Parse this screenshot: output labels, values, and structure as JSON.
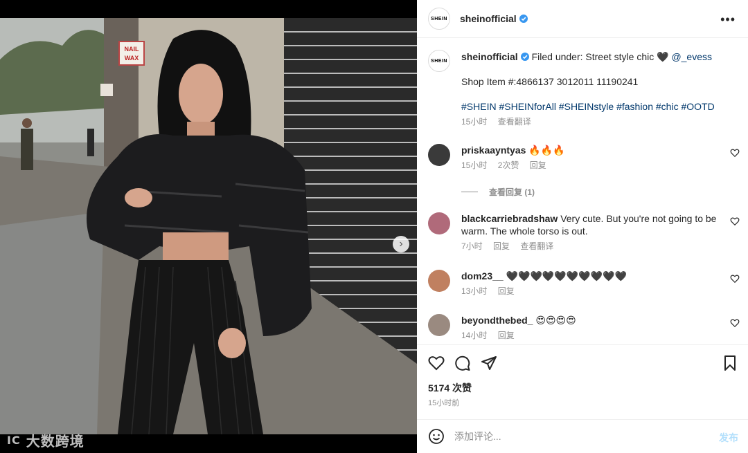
{
  "watermark": {
    "logo": "IC",
    "text": "大数跨境"
  },
  "header": {
    "avatar_text": "SHEIN",
    "username": "sheinofficial"
  },
  "caption": {
    "avatar_text": "SHEIN",
    "username": "sheinofficial",
    "text": "Filed under: Street style chic 🖤",
    "mention": "@_evess",
    "shop_line": "Shop Item #:4866137 3012011 11190241",
    "hashtags": "#SHEIN #SHEINforAll #SHEINstyle #fashion #chic #OOTD",
    "time": "15小时",
    "translate": "查看翻译"
  },
  "comments": [
    {
      "username": "priskaayntyas",
      "text": "🔥🔥🔥",
      "time": "15小时",
      "likes": "2次赞",
      "reply": "回复",
      "avatar_color": "#3a3a3a"
    },
    {
      "username": "blackcarriebradshaw",
      "text": "Very cute. But you're not going to be warm. The whole torso is out.",
      "time": "7小时",
      "reply": "回复",
      "translate": "查看翻译",
      "avatar_color": "#b06a7a"
    },
    {
      "username": "dom23__",
      "text": "🖤🖤🖤🖤🖤🖤🖤🖤🖤🖤",
      "time": "13小时",
      "reply": "回复",
      "avatar_color": "#c08060"
    },
    {
      "username": "beyondthebed_",
      "text": "😍😍😍😍",
      "time": "14小时",
      "reply": "回复",
      "avatar_color": "#9a8a80"
    }
  ],
  "view_replies": "查看回复 (1)",
  "likes": "5174 次赞",
  "post_time": "15小时前",
  "comment_box": {
    "placeholder": "添加评论...",
    "post_label": "发布"
  }
}
